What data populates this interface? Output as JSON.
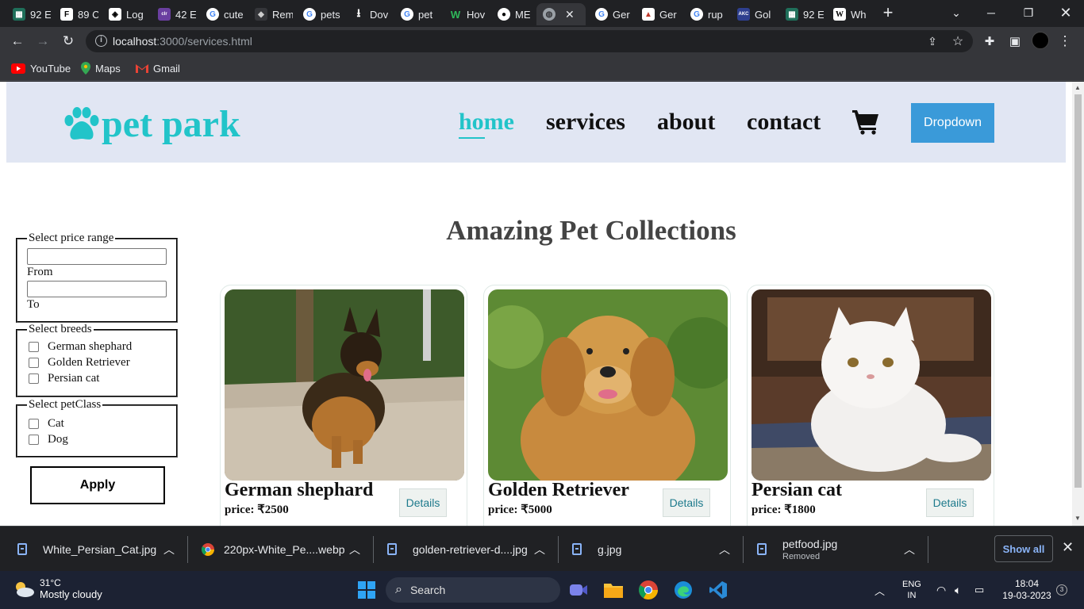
{
  "browser": {
    "tabs": [
      {
        "title": "92 E",
        "icon": "grid-icon",
        "color": "#1f6f5a"
      },
      {
        "title": "89 C",
        "icon": "f-icon",
        "color": "#444444"
      },
      {
        "title": "Log",
        "icon": "box-icon",
        "color": "#333333"
      },
      {
        "title": "42 E",
        "icon": "coloris-icon",
        "color": "#6a3fa0"
      },
      {
        "title": "cute",
        "icon": "google-icon",
        "color": "#ffffff"
      },
      {
        "title": "Rem",
        "icon": "layers-icon",
        "color": "#555555"
      },
      {
        "title": "pets",
        "icon": "google-icon",
        "color": "#ffffff"
      },
      {
        "title": "Dov",
        "icon": "download-icon",
        "color": "#202124"
      },
      {
        "title": "pet",
        "icon": "google-icon",
        "color": "#ffffff"
      },
      {
        "title": "Hov",
        "icon": "w-icon",
        "color": "#1f8f4a"
      },
      {
        "title": "ME",
        "icon": "github-icon",
        "color": "#ffffff"
      },
      {
        "title": "",
        "icon": "globe-icon",
        "color": "#9aa0a6"
      },
      {
        "title": "Ger",
        "icon": "google-icon",
        "color": "#ffffff"
      },
      {
        "title": "Ger",
        "icon": "gallery-icon",
        "color": "#c0392b"
      },
      {
        "title": "rup",
        "icon": "google-icon",
        "color": "#ffffff"
      },
      {
        "title": "Gol",
        "icon": "akc-icon",
        "color": "#2e3f8f"
      },
      {
        "title": "92 E",
        "icon": "grid-icon",
        "color": "#1f6f5a"
      },
      {
        "title": "Wh",
        "icon": "wikipedia-icon",
        "color": "#ffffff"
      }
    ],
    "url_host": "localhost",
    "url_rest": ":3000/services.html",
    "bookmarks": [
      {
        "label": "YouTube",
        "icon": "youtube-icon"
      },
      {
        "label": "Maps",
        "icon": "maps-icon"
      },
      {
        "label": "Gmail",
        "icon": "gmail-icon"
      }
    ]
  },
  "site": {
    "logo_text": "pet park",
    "nav": [
      {
        "label": "home",
        "active": true
      },
      {
        "label": "services",
        "active": false
      },
      {
        "label": "about",
        "active": false
      },
      {
        "label": "contact",
        "active": false
      }
    ],
    "dropdown_label": "Dropdown",
    "page_title": "Amazing Pet Collections",
    "colors": {
      "accent": "#22c4c9",
      "header_bg": "#e1e6f3",
      "dropdown_bg": "#3a9ad9"
    }
  },
  "filters": {
    "price": {
      "legend": "Select price range",
      "from_label": "From",
      "to_label": "To",
      "from_value": "",
      "to_value": ""
    },
    "breeds": {
      "legend": "Select breeds",
      "options": [
        "German shephard",
        "Golden Retriever",
        "Persian cat"
      ]
    },
    "pet_class": {
      "legend": "Select petClass",
      "options": [
        "Cat",
        "Dog"
      ]
    },
    "apply_label": "Apply"
  },
  "cards": [
    {
      "name": "German shephard",
      "price": "price: ₹2500",
      "details_label": "Details",
      "image": "german-shepherd-photo"
    },
    {
      "name": "Golden Retriever",
      "price": "price: ₹5000",
      "details_label": "Details",
      "image": "golden-retriever-photo"
    },
    {
      "name": "Persian cat",
      "price": "price: ₹1800",
      "details_label": "Details",
      "image": "persian-cat-photo"
    }
  ],
  "downloads": [
    {
      "filename": "White_Persian_Cat.jpg",
      "status": ""
    },
    {
      "filename": "220px-White_Pe....webp",
      "status": ""
    },
    {
      "filename": "golden-retriever-d....jpg",
      "status": ""
    },
    {
      "filename": "g.jpg",
      "status": ""
    },
    {
      "filename": "petfood.jpg",
      "status": "Removed"
    }
  ],
  "downloads_show_all": "Show all",
  "taskbar": {
    "temperature": "31°C",
    "weather_desc": "Mostly cloudy",
    "search_label": "Search",
    "lang_top": "ENG",
    "lang_bottom": "IN",
    "time": "18:04",
    "date": "19-03-2023",
    "notification_count": "3"
  }
}
